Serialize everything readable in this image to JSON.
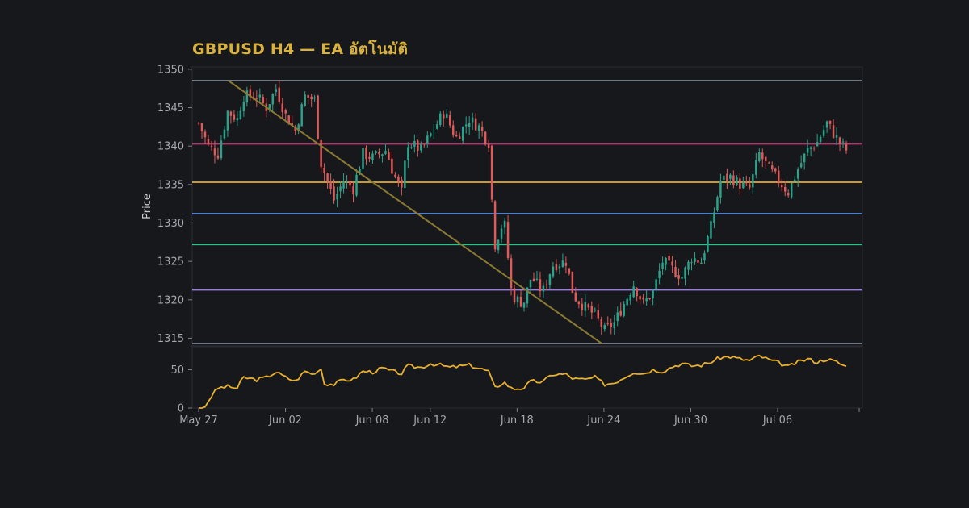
{
  "title": "GBPUSD H4 — EA อัตโนมัติ",
  "chart_data": {
    "type": "candlestick",
    "title": "GBPUSD H4 — EA อัตโนมัติ",
    "price_panel": {
      "ylabel": "Price",
      "ylim": [
        1314,
        1350.3
      ],
      "yticks": [
        1315,
        1320,
        1325,
        1330,
        1335,
        1340,
        1345,
        1350
      ],
      "horizontal_lines": [
        {
          "value": 1348.5,
          "color": "#8e97a3"
        },
        {
          "value": 1340.3,
          "color": "#e0629a"
        },
        {
          "value": 1335.3,
          "color": "#e2ad33"
        },
        {
          "value": 1331.2,
          "color": "#5e8fdb"
        },
        {
          "value": 1327.2,
          "color": "#2cc38a"
        },
        {
          "value": 1321.3,
          "color": "#9b7ee0"
        },
        {
          "value": 1314.3,
          "color": "#8e97a3"
        }
      ],
      "trendline": {
        "x": [
          "May 29",
          "Jun 23"
        ],
        "y": [
          1348.5,
          1314.3
        ],
        "color": "#8a7a33"
      },
      "up_color": "#2aa38b",
      "down_color": "#e05a5a",
      "candle_anchors": [
        {
          "day": 0.0,
          "price": 1343.0
        },
        {
          "day": 0.5,
          "price": 1340.0
        },
        {
          "day": 1.0,
          "price": 1339.0
        },
        {
          "day": 1.5,
          "price": 1344.5
        },
        {
          "day": 2.0,
          "price": 1343.5
        },
        {
          "day": 2.3,
          "price": 1346.5
        },
        {
          "day": 3.0,
          "price": 1346.5
        },
        {
          "day": 3.5,
          "price": 1345.0
        },
        {
          "day": 4.0,
          "price": 1347.5
        },
        {
          "day": 4.5,
          "price": 1344.0
        },
        {
          "day": 5.0,
          "price": 1342.0
        },
        {
          "day": 5.5,
          "price": 1346.5
        },
        {
          "day": 6.0,
          "price": 1346.0
        },
        {
          "day": 6.3,
          "price": 1338.0
        },
        {
          "day": 7.0,
          "price": 1333.0
        },
        {
          "day": 7.5,
          "price": 1335.5
        },
        {
          "day": 8.0,
          "price": 1334.5
        },
        {
          "day": 8.5,
          "price": 1339.0
        },
        {
          "day": 9.0,
          "price": 1338.5
        },
        {
          "day": 9.7,
          "price": 1339.5
        },
        {
          "day": 10.0,
          "price": 1337.0
        },
        {
          "day": 10.5,
          "price": 1334.0
        },
        {
          "day": 10.8,
          "price": 1340.5
        },
        {
          "day": 11.5,
          "price": 1339.5
        },
        {
          "day": 12.0,
          "price": 1341.5
        },
        {
          "day": 12.7,
          "price": 1344.5
        },
        {
          "day": 13.3,
          "price": 1341.0
        },
        {
          "day": 14.0,
          "price": 1343.5
        },
        {
          "day": 14.5,
          "price": 1342.5
        },
        {
          "day": 15.0,
          "price": 1340.5
        },
        {
          "day": 15.3,
          "price": 1327.0
        },
        {
          "day": 15.8,
          "price": 1330.5
        },
        {
          "day": 16.2,
          "price": 1320.5
        },
        {
          "day": 16.8,
          "price": 1319.5
        },
        {
          "day": 17.2,
          "price": 1323.0
        },
        {
          "day": 17.8,
          "price": 1321.0
        },
        {
          "day": 18.3,
          "price": 1324.5
        },
        {
          "day": 19.0,
          "price": 1325.0
        },
        {
          "day": 19.4,
          "price": 1320.5
        },
        {
          "day": 20.0,
          "price": 1319.0
        },
        {
          "day": 20.5,
          "price": 1318.0
        },
        {
          "day": 21.0,
          "price": 1316.0
        },
        {
          "day": 21.5,
          "price": 1317.0
        },
        {
          "day": 22.0,
          "price": 1319.5
        },
        {
          "day": 22.5,
          "price": 1322.0
        },
        {
          "day": 23.0,
          "price": 1319.5
        },
        {
          "day": 23.5,
          "price": 1321.0
        },
        {
          "day": 24.0,
          "price": 1325.0
        },
        {
          "day": 24.5,
          "price": 1324.0
        },
        {
          "day": 25.0,
          "price": 1323.0
        },
        {
          "day": 25.5,
          "price": 1325.5
        },
        {
          "day": 26.0,
          "price": 1325.0
        },
        {
          "day": 26.5,
          "price": 1329.5
        },
        {
          "day": 27.0,
          "price": 1335.5
        },
        {
          "day": 27.5,
          "price": 1336.0
        },
        {
          "day": 28.0,
          "price": 1335.0
        },
        {
          "day": 28.5,
          "price": 1334.5
        },
        {
          "day": 29.0,
          "price": 1339.0
        },
        {
          "day": 29.5,
          "price": 1337.0
        },
        {
          "day": 30.0,
          "price": 1335.5
        },
        {
          "day": 30.5,
          "price": 1334.0
        },
        {
          "day": 31.0,
          "price": 1337.0
        },
        {
          "day": 31.5,
          "price": 1339.5
        },
        {
          "day": 32.0,
          "price": 1340.5
        },
        {
          "day": 32.5,
          "price": 1343.0
        },
        {
          "day": 33.0,
          "price": 1341.0
        },
        {
          "day": 33.5,
          "price": 1339.5
        }
      ]
    },
    "indicator_panel": {
      "ylim": [
        0,
        80
      ],
      "yticks": [
        0,
        50
      ],
      "color": "#e8b02e",
      "anchors": [
        {
          "day": 0.0,
          "value": 0
        },
        {
          "day": 0.3,
          "value": 0
        },
        {
          "day": 0.6,
          "value": 14
        },
        {
          "day": 1.0,
          "value": 26
        },
        {
          "day": 1.5,
          "value": 28
        },
        {
          "day": 2.0,
          "value": 26
        },
        {
          "day": 2.3,
          "value": 40
        },
        {
          "day": 3.0,
          "value": 37
        },
        {
          "day": 3.5,
          "value": 40
        },
        {
          "day": 4.0,
          "value": 47
        },
        {
          "day": 4.5,
          "value": 40
        },
        {
          "day": 5.0,
          "value": 35
        },
        {
          "day": 5.5,
          "value": 48
        },
        {
          "day": 6.0,
          "value": 44
        },
        {
          "day": 6.3,
          "value": 55
        },
        {
          "day": 6.5,
          "value": 32
        },
        {
          "day": 7.0,
          "value": 31
        },
        {
          "day": 7.5,
          "value": 37
        },
        {
          "day": 8.0,
          "value": 37
        },
        {
          "day": 8.5,
          "value": 48
        },
        {
          "day": 9.0,
          "value": 47
        },
        {
          "day": 9.5,
          "value": 52
        },
        {
          "day": 10.0,
          "value": 48
        },
        {
          "day": 10.5,
          "value": 45
        },
        {
          "day": 10.8,
          "value": 55
        },
        {
          "day": 11.5,
          "value": 53
        },
        {
          "day": 12.0,
          "value": 58
        },
        {
          "day": 12.5,
          "value": 56
        },
        {
          "day": 13.0,
          "value": 53
        },
        {
          "day": 14.0,
          "value": 56
        },
        {
          "day": 14.5,
          "value": 52
        },
        {
          "day": 15.0,
          "value": 48
        },
        {
          "day": 15.3,
          "value": 26
        },
        {
          "day": 15.8,
          "value": 34
        },
        {
          "day": 16.2,
          "value": 25
        },
        {
          "day": 16.8,
          "value": 26
        },
        {
          "day": 17.2,
          "value": 35
        },
        {
          "day": 17.8,
          "value": 34
        },
        {
          "day": 18.3,
          "value": 44
        },
        {
          "day": 19.0,
          "value": 44
        },
        {
          "day": 19.4,
          "value": 38
        },
        {
          "day": 20.0,
          "value": 37
        },
        {
          "day": 20.5,
          "value": 40
        },
        {
          "day": 21.0,
          "value": 31
        },
        {
          "day": 21.5,
          "value": 33
        },
        {
          "day": 22.0,
          "value": 40
        },
        {
          "day": 22.5,
          "value": 47
        },
        {
          "day": 23.0,
          "value": 45
        },
        {
          "day": 23.5,
          "value": 50
        },
        {
          "day": 24.0,
          "value": 48
        },
        {
          "day": 24.5,
          "value": 54
        },
        {
          "day": 25.0,
          "value": 58
        },
        {
          "day": 25.5,
          "value": 55
        },
        {
          "day": 26.0,
          "value": 56
        },
        {
          "day": 26.5,
          "value": 60
        },
        {
          "day": 27.0,
          "value": 66
        },
        {
          "day": 27.5,
          "value": 67
        },
        {
          "day": 28.0,
          "value": 64
        },
        {
          "day": 28.5,
          "value": 62
        },
        {
          "day": 29.0,
          "value": 68
        },
        {
          "day": 29.5,
          "value": 63
        },
        {
          "day": 30.0,
          "value": 59
        },
        {
          "day": 30.5,
          "value": 54
        },
        {
          "day": 31.0,
          "value": 60
        },
        {
          "day": 31.5,
          "value": 64
        },
        {
          "day": 32.0,
          "value": 60
        },
        {
          "day": 32.5,
          "value": 64
        },
        {
          "day": 33.0,
          "value": 60
        },
        {
          "day": 33.5,
          "value": 54
        }
      ]
    },
    "x_axis": {
      "start": "May 27",
      "span_days": 34,
      "ticks": [
        {
          "label": "May 27",
          "day": 0
        },
        {
          "label": "Jun 02",
          "day": 6
        },
        {
          "label": "Jun 08",
          "day": 12
        },
        {
          "label": "Jun 12",
          "day": 16
        },
        {
          "label": "Jun 18",
          "day": 22
        },
        {
          "label": "Jun 24",
          "day": 28
        },
        {
          "label": "Jun 30",
          "day": 34
        },
        {
          "label": "Jul 06",
          "day": 40
        }
      ]
    },
    "grid": false
  }
}
